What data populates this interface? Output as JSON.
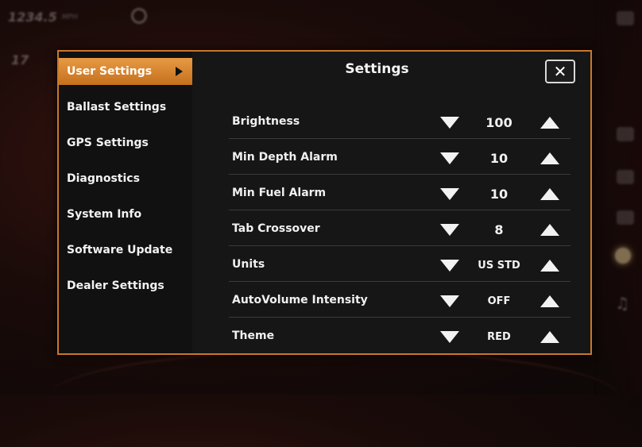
{
  "background": {
    "speed_value": "1234.5",
    "speed_unit": "MPH",
    "second_value": "17"
  },
  "sidebar": {
    "items": [
      {
        "label": "User Settings",
        "active": true
      },
      {
        "label": "Ballast Settings",
        "active": false
      },
      {
        "label": "GPS Settings",
        "active": false
      },
      {
        "label": "Diagnostics",
        "active": false
      },
      {
        "label": "System Info",
        "active": false
      },
      {
        "label": "Software Update",
        "active": false
      },
      {
        "label": "Dealer Settings",
        "active": false
      }
    ]
  },
  "dialog": {
    "title": "Settings",
    "close_label": "✕"
  },
  "settings": [
    {
      "label": "Brightness",
      "value": "100"
    },
    {
      "label": "Min Depth Alarm",
      "value": "10"
    },
    {
      "label": "Min Fuel Alarm",
      "value": "10"
    },
    {
      "label": "Tab Crossover",
      "value": "8"
    },
    {
      "label": "Units",
      "value": "US STD"
    },
    {
      "label": "AutoVolume Intensity",
      "value": "OFF"
    },
    {
      "label": "Theme",
      "value": "RED"
    }
  ],
  "colors": {
    "accent": "#e0893a",
    "panel": "#161617",
    "sidebar": "#111112"
  },
  "icons": {
    "decrease": "triangle-down-icon",
    "increase": "triangle-up-icon",
    "close": "close-icon",
    "active_caret": "caret-right-icon"
  }
}
